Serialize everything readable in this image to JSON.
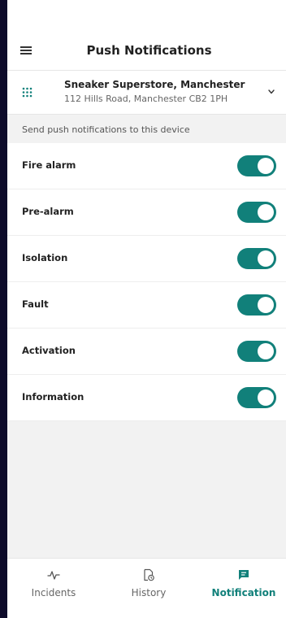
{
  "header": {
    "title": "Push Notifications",
    "menu_icon": "hamburger-menu-icon"
  },
  "site": {
    "name": "Sneaker Superstore, Manchester",
    "address": "112 Hills Road, Manchester CB2 1PH",
    "icon": "panel-grid-icon"
  },
  "section_label": "Send push notifications to this device",
  "notifications": [
    {
      "label": "Fire alarm",
      "enabled": true
    },
    {
      "label": "Pre-alarm",
      "enabled": true
    },
    {
      "label": "Isolation",
      "enabled": true
    },
    {
      "label": "Fault",
      "enabled": true
    },
    {
      "label": "Activation",
      "enabled": true
    },
    {
      "label": "Information",
      "enabled": true
    }
  ],
  "bottom_nav": [
    {
      "label": "Incidents",
      "icon": "pulse-icon",
      "active": false
    },
    {
      "label": "History",
      "icon": "history-document-icon",
      "active": false
    },
    {
      "label": "Notification",
      "icon": "chat-bubble-icon",
      "active": true
    }
  ],
  "colors": {
    "accent": "#11807a",
    "background": "#f2f2f2",
    "frame": "#0d0b2a"
  }
}
